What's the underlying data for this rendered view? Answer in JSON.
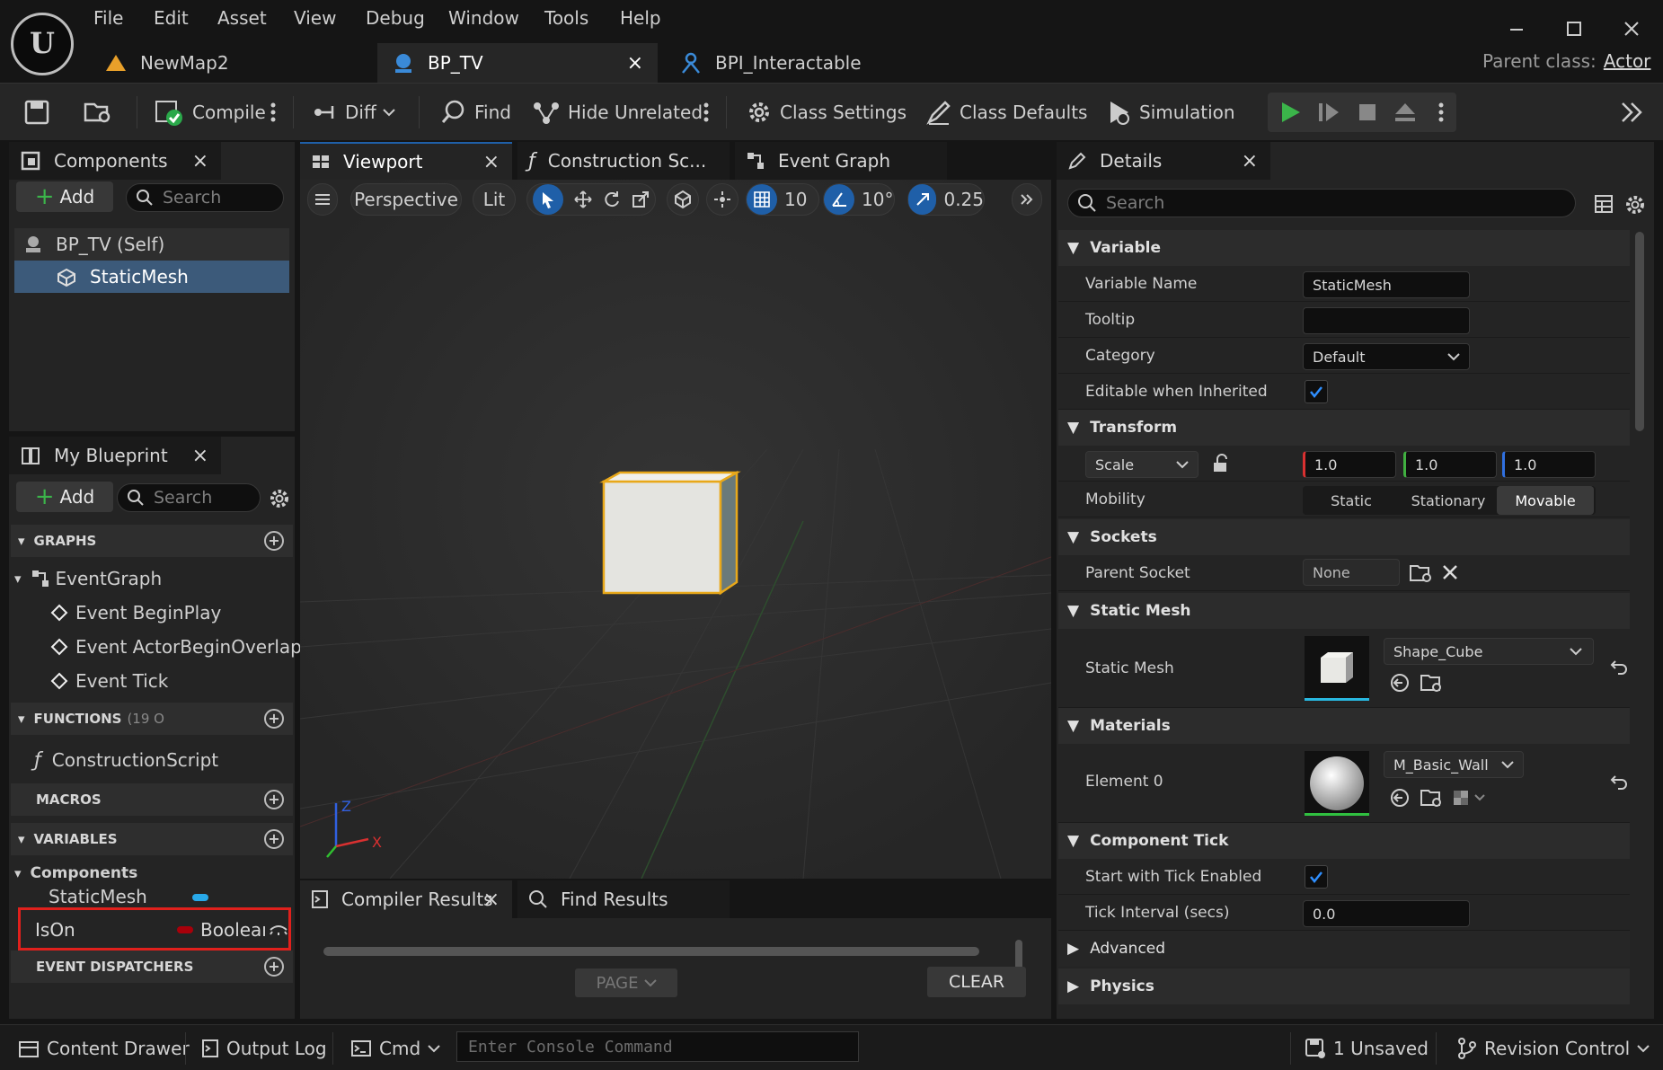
{
  "menu": [
    "File",
    "Edit",
    "Asset",
    "View",
    "Debug",
    "Window",
    "Tools",
    "Help"
  ],
  "tabs": [
    {
      "label": "NewMap2"
    },
    {
      "label": "BP_TV"
    },
    {
      "label": "BPI_Interactable"
    }
  ],
  "parent_class": {
    "label": "Parent class:",
    "value": "Actor"
  },
  "toolbar": {
    "compile": "Compile",
    "diff": "Diff",
    "find": "Find",
    "hide_unrelated": "Hide Unrelated",
    "class_settings": "Class Settings",
    "class_defaults": "Class Defaults",
    "simulation": "Simulation"
  },
  "components": {
    "tab_label": "Components",
    "add_label": "Add",
    "search_placeholder": "Search",
    "items": [
      "BP_TV (Self)",
      "StaticMesh"
    ]
  },
  "my_blueprint": {
    "tab_label": "My Blueprint",
    "add_label": "Add",
    "search_placeholder": "Search",
    "graphs_label": "GRAPHS",
    "event_graph": "EventGraph",
    "events": [
      "Event BeginPlay",
      "Event ActorBeginOverlap",
      "Event Tick"
    ],
    "functions_label": "FUNCTIONS",
    "functions_count": "(19 O",
    "construction_script": "ConstructionScript",
    "macros_label": "MACROS",
    "variables_label": "VARIABLES",
    "components_group": "Components",
    "static_mesh_var": "StaticMesh",
    "ison_var": "IsOn",
    "ison_type": "Booleaı",
    "event_dispatchers_label": "EVENT DISPATCHERS"
  },
  "center_tabs": {
    "viewport": "Viewport",
    "construction": "Construction Sc...",
    "event_graph": "Event Graph"
  },
  "viewport": {
    "perspective": "Perspective",
    "lit": "Lit",
    "grid_snap": "10",
    "rot_snap": "10°",
    "scale_snap": "0.25",
    "axis_z": "Z",
    "axis_x": "X"
  },
  "bottom_panel": {
    "compiler_results": "Compiler Results",
    "find_results": "Find Results",
    "page": "PAGE",
    "clear": "CLEAR"
  },
  "details": {
    "tab_label": "Details",
    "search_placeholder": "Search",
    "variable_hdr": "Variable",
    "variable_name_lbl": "Variable Name",
    "variable_name_val": "StaticMesh",
    "tooltip_lbl": "Tooltip",
    "category_lbl": "Category",
    "category_val": "Default",
    "editable_lbl": "Editable when Inherited",
    "transform_hdr": "Transform",
    "scale_lbl": "Scale",
    "scale_x": "1.0",
    "scale_y": "1.0",
    "scale_z": "1.0",
    "mobility_lbl": "Mobility",
    "mobility_options": [
      "Static",
      "Stationary",
      "Movable"
    ],
    "sockets_hdr": "Sockets",
    "parent_socket_lbl": "Parent Socket",
    "parent_socket_val": "None",
    "static_mesh_hdr": "Static Mesh",
    "static_mesh_lbl": "Static Mesh",
    "static_mesh_val": "Shape_Cube",
    "materials_hdr": "Materials",
    "element0_lbl": "Element 0",
    "element0_val": "M_Basic_Wall",
    "component_tick_hdr": "Component Tick",
    "start_tick_lbl": "Start with Tick Enabled",
    "tick_interval_lbl": "Tick Interval (secs)",
    "tick_interval_val": "0.0",
    "advanced_hdr": "Advanced",
    "physics_hdr": "Physics"
  },
  "statusbar": {
    "content_drawer": "Content Drawer",
    "output_log": "Output Log",
    "cmd": "Cmd",
    "console_placeholder": "Enter Console Command",
    "unsaved": "1 Unsaved",
    "revision_control": "Revision Control"
  },
  "colors": {
    "accent_blue": "#1f5fa8",
    "highlight_red": "#e0201c",
    "selection": "#3c5a7a"
  }
}
